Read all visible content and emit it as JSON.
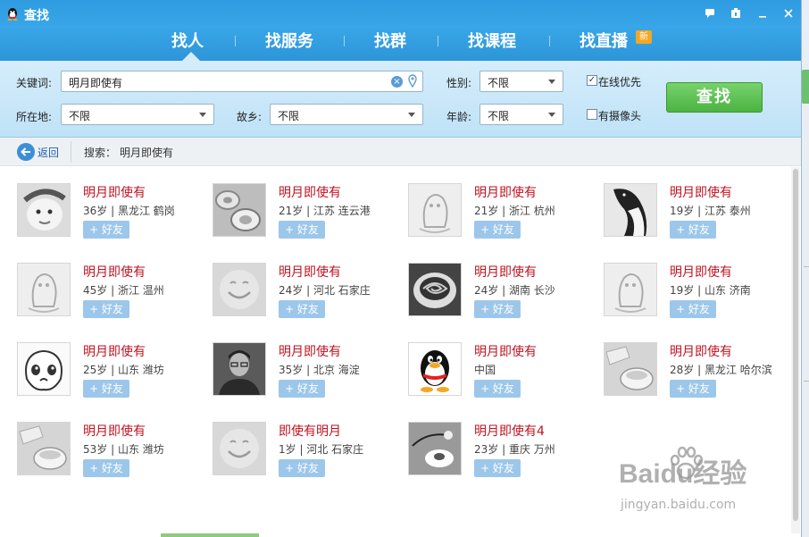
{
  "window": {
    "title": "查找"
  },
  "window_controls": [
    "message-icon",
    "skin-icon",
    "minimize-icon",
    "close-icon"
  ],
  "nav": {
    "tabs": [
      "找人",
      "找服务",
      "找群",
      "找课程",
      "找直播"
    ],
    "active_index": 0,
    "new_badge": "新"
  },
  "filters": {
    "keyword_label": "关键词:",
    "keyword_value": "明月即使有",
    "gender_label": "性别:",
    "gender_value": "不限",
    "location_label": "所在地:",
    "location_value": "不限",
    "hometown_label": "故乡:",
    "hometown_value": "不限",
    "age_label": "年龄:",
    "age_value": "不限",
    "online_first_label": "在线优先",
    "online_first_checked": true,
    "has_camera_label": "有摄像头",
    "has_camera_checked": false,
    "search_button": "查找"
  },
  "toolbar": {
    "back_label": "返回",
    "search_label": "搜索：",
    "search_query": "明月即使有"
  },
  "add_friend_label": "+ 好友",
  "results": [
    {
      "name": "明月即使有",
      "info": "36岁 | 黑龙江 鹤岗",
      "avatar": "baby-photo"
    },
    {
      "name": "明月即使有",
      "info": "21岁 | 江苏 连云港",
      "avatar": "cups-photo"
    },
    {
      "name": "明月即使有",
      "info": "21岁 | 浙江 杭州",
      "avatar": "default-avatar-grey"
    },
    {
      "name": "明月即使有",
      "info": "19岁 | 江苏 泰州",
      "avatar": "penguin-photo"
    },
    {
      "name": "明月即使有",
      "info": "45岁 | 浙江 温州",
      "avatar": "default-avatar-grey"
    },
    {
      "name": "明月即使有",
      "info": "24岁 | 河北 石家庄",
      "avatar": "smile-avatar"
    },
    {
      "name": "明月即使有",
      "info": "24岁 | 湖南 长沙",
      "avatar": "coffee-photo"
    },
    {
      "name": "明月即使有",
      "info": "19岁 | 山东 济南",
      "avatar": "default-avatar-grey"
    },
    {
      "name": "明月即使有",
      "info": "25岁 | 山东 潍坊",
      "avatar": "cartoon-avatar"
    },
    {
      "name": "明月即使有",
      "info": "35岁 | 北京 海淀",
      "avatar": "man-photo"
    },
    {
      "name": "明月即使有",
      "info": "中国",
      "avatar": "qq-penguin"
    },
    {
      "name": "明月即使有",
      "info": "28岁 | 黑龙江 哈尔滨",
      "avatar": "cup-photo"
    },
    {
      "name": "明月即使有",
      "info": "53岁 | 山东 潍坊",
      "avatar": "cup-photo"
    },
    {
      "name": "即使有明月",
      "info": "1岁 | 河北 石家庄",
      "avatar": "smile-avatar"
    },
    {
      "name": "明月即使有4",
      "info": "23岁 | 重庆 万州",
      "avatar": "flower-photo"
    }
  ],
  "watermark": {
    "logo": "Baidu经验",
    "url": "jingyan.baidu.com"
  }
}
